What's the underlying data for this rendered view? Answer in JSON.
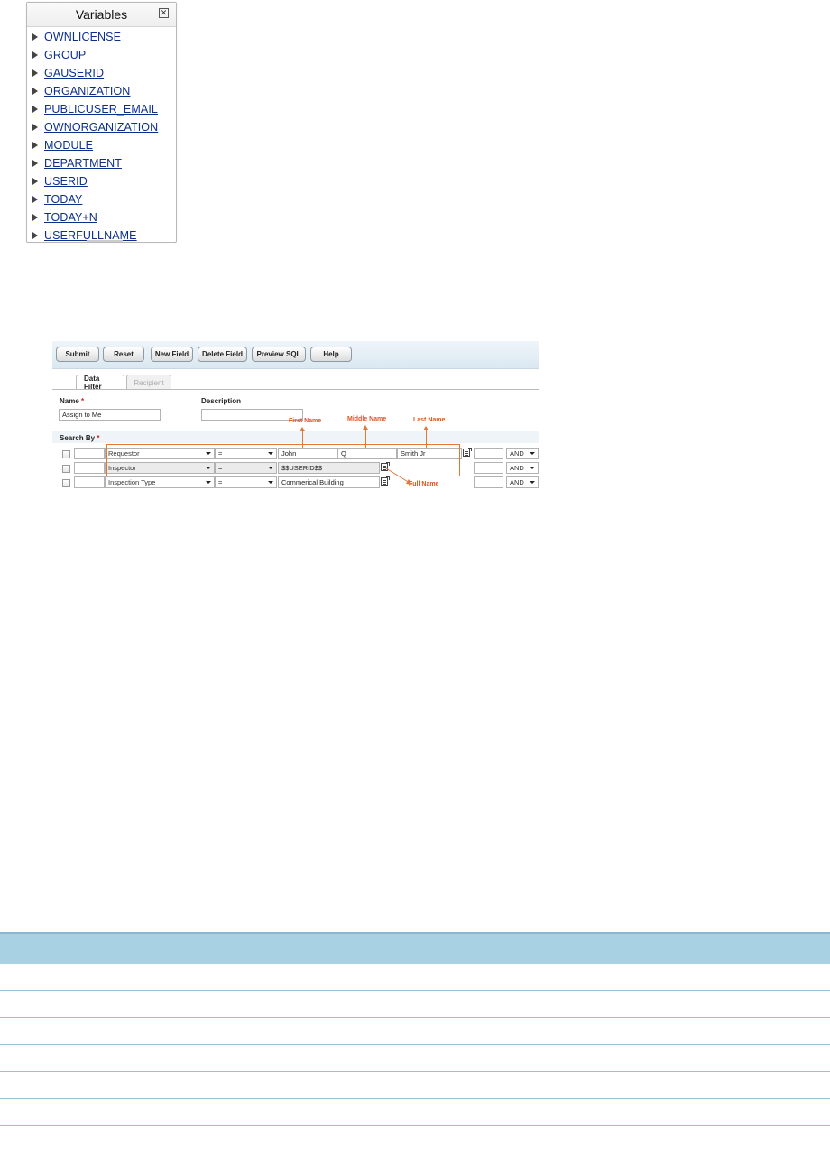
{
  "variables_panel": {
    "title": "Variables",
    "close_glyph": "✕",
    "items": [
      "OWNLICENSE",
      "GROUP",
      "GAUSERID",
      "ORGANIZATION",
      "PUBLICUSER_EMAIL",
      "OWNORGANIZATION",
      "MODULE",
      "DEPARTMENT",
      "USERID",
      "TODAY",
      "TODAY+N",
      "USERFULLNAME"
    ]
  },
  "toolbar": {
    "submit": "Submit",
    "reset": "Reset",
    "new_field": "New Field",
    "delete_field": "Delete Field",
    "preview_sql": "Preview SQL",
    "help": "Help"
  },
  "tabs": {
    "data_filter": "Data Filter",
    "recipient": "Recipient"
  },
  "form": {
    "name_label": "Name",
    "required_mark": "*",
    "name_value": "Assign to Me",
    "description_label": "Description",
    "description_value": "",
    "search_by_label": "Search By"
  },
  "rows": [
    {
      "field": "Requestor",
      "operator": "=",
      "value1": "John",
      "value2": "Q",
      "value3": "Smith Jr",
      "logic": "AND"
    },
    {
      "field": "Inspector",
      "operator": "=",
      "value1": "$$USERID$$",
      "logic": "AND"
    },
    {
      "field": "Inspection Type",
      "operator": "=",
      "value1": "Commerical Building",
      "logic": "AND"
    }
  ],
  "annotations": {
    "first_name": "First Name",
    "middle_name": "Middle Name",
    "last_name": "Last Name",
    "full_name": "Full Name"
  },
  "colors": {
    "annotation": "#e47637",
    "link": "#0d2f8c",
    "table_header": "#a8d1e4"
  }
}
